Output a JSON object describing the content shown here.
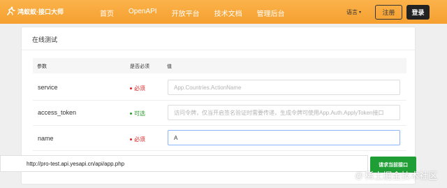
{
  "header": {
    "logo_text": "鸿蚁蚁·接口大师",
    "nav": [
      "首页",
      "OpenAPI",
      "开放平台",
      "技术文档",
      "管理后台"
    ],
    "language": "语言",
    "register": "注册",
    "login": "登录"
  },
  "panel": {
    "title": "在线测试",
    "columns": {
      "param": "参数",
      "required": "是否必须",
      "value": "值"
    },
    "rows": [
      {
        "name": "service",
        "required": "必须",
        "required_type": "must",
        "value": "",
        "placeholder": "App.Countries.ActionName"
      },
      {
        "name": "access_token",
        "required": "可选",
        "required_type": "optional",
        "value": "",
        "placeholder": "访问令牌，仅当开启签名验证时需要传递，生成令牌可使用App.Auth.ApplyToken接口"
      },
      {
        "name": "name",
        "required": "必须",
        "required_type": "must",
        "value": "A",
        "placeholder": ""
      }
    ]
  },
  "request": {
    "url": "http://pro-test.api.yesapi.cn/api/app.php",
    "button": "请求当前接口"
  },
  "watermark": {
    "at": "@",
    "text": "稀土掘金技术社区"
  },
  "colors": {
    "header": "#f5a030",
    "must": "#e02020",
    "optional": "#2a9d2a",
    "request_button": "#1f9e36"
  },
  "icons": {
    "logo": "running-figure-icon",
    "language_caret": "chevron-down-icon"
  }
}
